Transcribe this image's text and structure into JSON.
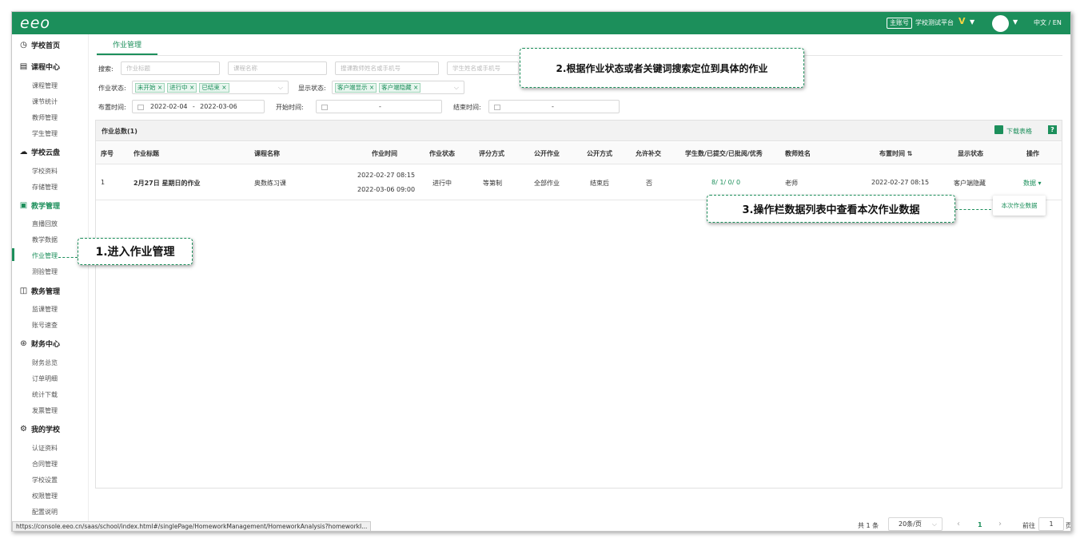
{
  "topbar": {
    "logo": "eeo",
    "account_badge": "主账号",
    "school_name": "学校测试平台",
    "vip_badge": "V",
    "language": "中文 / EN"
  },
  "sidebar": {
    "sections": [
      {
        "label": "学校首页",
        "icon": "dashboard-icon",
        "items": []
      },
      {
        "label": "课程中心",
        "icon": "calendar-icon",
        "items": [
          "课程管理",
          "课节统计",
          "教师管理",
          "学生管理"
        ]
      },
      {
        "label": "学校云盘",
        "icon": "cloud-icon",
        "items": [
          "学校资料",
          "存储管理"
        ]
      },
      {
        "label": "教学管理",
        "icon": "monitor-icon",
        "items": [
          "直播回放",
          "教学数据",
          "作业管理",
          "测验管理"
        ]
      },
      {
        "label": "教务管理",
        "icon": "grid-icon",
        "items": [
          "监课管理",
          "账号速查"
        ]
      },
      {
        "label": "财务中心",
        "icon": "yen-icon",
        "items": [
          "财务总览",
          "订单明细",
          "统计下载",
          "发票管理"
        ]
      },
      {
        "label": "我的学校",
        "icon": "gear-icon",
        "items": [
          "认证资料",
          "合同管理",
          "学校设置",
          "权限管理",
          "配置说明"
        ]
      }
    ],
    "active_item": "作业管理"
  },
  "main": {
    "tab": "作业管理",
    "filters": {
      "search_label": "搜索:",
      "search_inputs": [
        "作业标题",
        "课程名称",
        "搜课教师姓名或手机号",
        "学生姓名或手机号"
      ],
      "hw_status_label": "作业状态:",
      "hw_status_tags": [
        "未开始 ×",
        "进行中 ×",
        "已结束 ×"
      ],
      "display_status_label": "显示状态:",
      "display_status_tags": [
        "客户端显示 ×",
        "客户端隐藏 ×"
      ],
      "assign_time_label": "布置时间:",
      "assign_start": "2022-02-04",
      "assign_sep": "-",
      "assign_end": "2022-03-06",
      "start_time_label": "开始时间:",
      "end_time_label": "结束时间:",
      "empty_range": "-"
    },
    "table": {
      "total_label": "作业总数(1)",
      "download_label": "下载表格",
      "help_label": "?",
      "columns": [
        "序号",
        "作业标题",
        "课程名称",
        "作业时间",
        "作业状态",
        "评分方式",
        "公开作业",
        "公开方式",
        "允许补交",
        "学生数/已提交/已批阅/优秀",
        "教师姓名",
        "布置时间 ⇅",
        "显示状态",
        "操作"
      ],
      "rows": [
        {
          "index": "1",
          "title": "2月27日 星期日的作业",
          "course": "奥数练习课",
          "time_start": "2022-02-27 08:15",
          "time_end": "2022-03-06 09:00",
          "status": "进行中",
          "grading": "等第制",
          "public": "全部作业",
          "public_mode": "结束后",
          "allow_late": "否",
          "stats": "8/ 1/ 0/ 0",
          "teacher": "老师",
          "assigned": "2022-02-27 08:15",
          "display": "客户端隐藏",
          "action": "数据 ▾"
        }
      ],
      "dropdown_item": "本次作业数据"
    },
    "pagination": {
      "total": "共 1 条",
      "page_size": "20条/页",
      "prev": "‹",
      "current": "1",
      "next": "›",
      "goto_label": "前往",
      "goto_value": "1",
      "page_suffix": "页"
    }
  },
  "status_url": "https://console.eeo.cn/saas/school/index.html#/singlePage/HomeworkManagement/HomeworkAnalysis?homeworkI...",
  "callouts": {
    "step1": "1.进入作业管理",
    "step2": "2.根据作业状态或者关键词搜索定位到具体的作业",
    "step3": "3.操作栏数据列表中查看本次作业数据"
  },
  "colors": {
    "brand": "#1c8f5b",
    "tag_bg": "#e8f6ef"
  }
}
